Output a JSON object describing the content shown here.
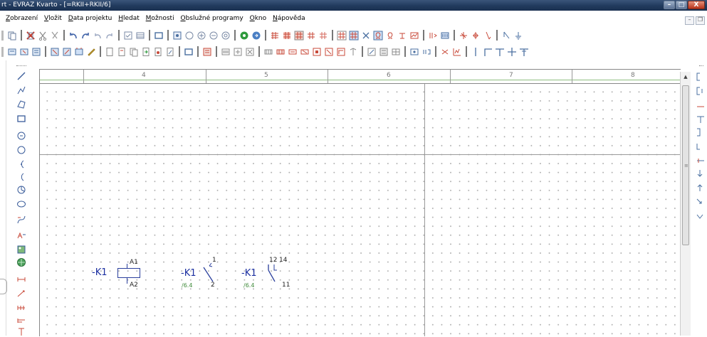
{
  "window": {
    "title": "rt - EVRAZ Kvarto - [=RKII+RKII/6]",
    "controls": {
      "minimize": "–",
      "maximize": "□",
      "close": "X"
    }
  },
  "menu": {
    "items": [
      {
        "underline": "Z",
        "rest": "obrazení"
      },
      {
        "underline": "V",
        "rest": "ložit"
      },
      {
        "underline": "D",
        "rest": "ata projektu"
      },
      {
        "underline": "H",
        "rest": "ledat"
      },
      {
        "underline": "M",
        "rest": "ožnosti"
      },
      {
        "underline": "O",
        "rest": "bslužné programy"
      },
      {
        "underline": "O",
        "rest": "kno"
      },
      {
        "underline": "N",
        "rest": "ápověda"
      }
    ],
    "mdi_controls": {
      "minimize": "–",
      "restore": "❐"
    }
  },
  "ruler": {
    "columns": [
      "4",
      "5",
      "6",
      "7",
      "8"
    ]
  },
  "schematic": {
    "coil": {
      "tag": "-K1",
      "pin_top": "A1",
      "pin_bottom": "A2"
    },
    "contact1": {
      "tag": "-K1",
      "pin_top": "1",
      "pin_bottom": "2",
      "xref": "/6.4"
    },
    "contact2": {
      "tag": "-K1",
      "pin_top": "12",
      "pin_top2": "14",
      "pin_bottom": "11",
      "xref": "/6.4"
    }
  },
  "colors": {
    "titlebar": "#213a5d",
    "symbol": "#2a3f9c",
    "xref": "#3f8a3a",
    "grid_dot": "#a9a9a9"
  }
}
